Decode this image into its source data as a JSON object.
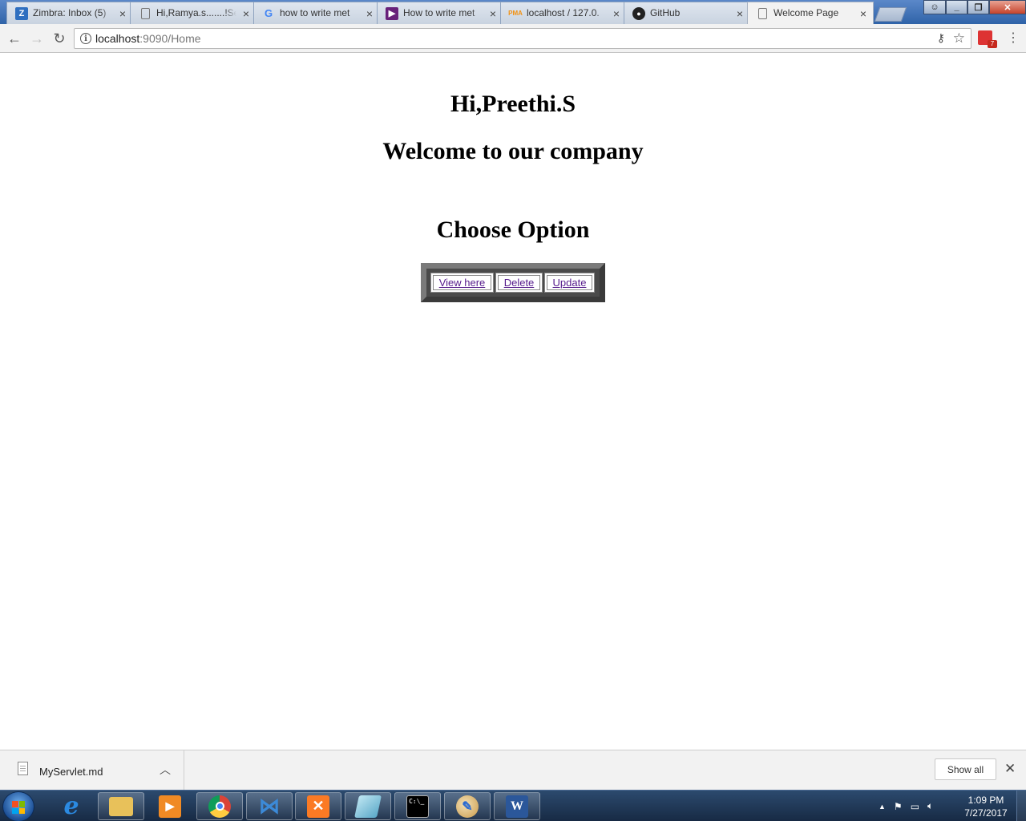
{
  "browser": {
    "tabs": [
      {
        "title": "Zimbra: Inbox (5)",
        "icon": "zimbra-icon",
        "icon_color": "#2f6fc0"
      },
      {
        "title": "Hi,Ramya.s.......!Se",
        "icon": "page-icon",
        "icon_color": "#777777"
      },
      {
        "title": "how to write met",
        "icon": "google-icon",
        "icon_color": "#4285f4"
      },
      {
        "title": "How to write met",
        "icon": "visual-studio-icon",
        "icon_color": "#68217a"
      },
      {
        "title": "localhost / 127.0.",
        "icon": "phpmyadmin-icon",
        "icon_color": "#f29111"
      },
      {
        "title": "GitHub",
        "icon": "github-icon",
        "icon_color": "#222222"
      },
      {
        "title": "Welcome Page",
        "icon": "page-icon",
        "icon_color": "#777777",
        "active": true
      }
    ],
    "url_host": "localhost",
    "url_rest": ":9090/Home",
    "extension_badge": "7"
  },
  "page": {
    "greeting": "Hi,Preethi.S",
    "welcome": "Welcome to our company",
    "choose_heading": "Choose Option",
    "options": [
      {
        "label": "View here"
      },
      {
        "label": "Delete"
      },
      {
        "label": "Update"
      }
    ],
    "link_color": "#551a8b"
  },
  "download_shelf": {
    "file_name": "MyServlet.md",
    "show_all_label": "Show all"
  },
  "taskbar": {
    "apps": [
      {
        "name": "internet-explorer-icon",
        "glyph": "e",
        "color": "#2b8ae2"
      },
      {
        "name": "file-explorer-icon",
        "glyph": "▤",
        "color": "#e8c15a"
      },
      {
        "name": "media-player-icon",
        "glyph": "▶",
        "color": "#f08a24"
      },
      {
        "name": "chrome-icon",
        "glyph": "◉",
        "color": "#db4437"
      },
      {
        "name": "visual-studio-code-icon",
        "glyph": "⋈",
        "color": "#3c8ad8"
      },
      {
        "name": "xampp-icon",
        "glyph": "✕",
        "color": "#fb7a24"
      },
      {
        "name": "notepad-icon",
        "glyph": "▰",
        "color": "#7fc2d8"
      },
      {
        "name": "command-prompt-icon",
        "glyph": "C:\\_",
        "color": "#000000"
      },
      {
        "name": "paint-icon",
        "glyph": "✎",
        "color": "#d6a84b"
      },
      {
        "name": "word-icon",
        "glyph": "W",
        "color": "#2b579a"
      }
    ],
    "time": "1:09 PM",
    "date": "7/27/2017"
  }
}
